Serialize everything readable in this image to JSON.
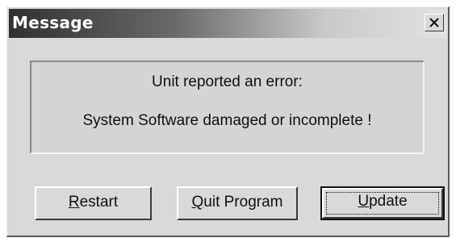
{
  "window": {
    "title": "Message",
    "close_icon": "close-icon"
  },
  "message": {
    "line1": "Unit reported an error:",
    "line2": "System Software damaged or incomplete !"
  },
  "buttons": {
    "restart": {
      "accel": "R",
      "rest": "estart"
    },
    "quit": {
      "accel": "Q",
      "rest": "uit Program"
    },
    "update": {
      "accel": "U",
      "rest": "pdate"
    }
  },
  "colors": {
    "dialog_bg": "#d9d9d9",
    "titlebar_dark": "#303030",
    "titlebar_light": "#e2e2e2",
    "text": "#111111"
  }
}
